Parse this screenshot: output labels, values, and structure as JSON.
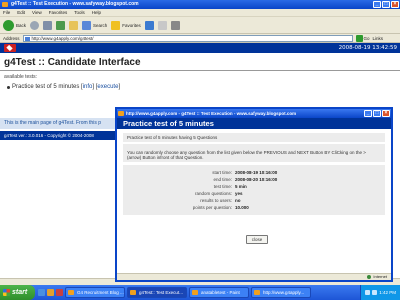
{
  "browser": {
    "title": "g4Test :: Test Execution - www.safyway.blogspot.com",
    "menu": [
      "File",
      "Edit",
      "View",
      "Favorites",
      "Tools",
      "Help"
    ],
    "back_label": "Back",
    "search_label": "Search",
    "favorites_label": "Favorites",
    "address_label": "Address",
    "url": "http://www.g4apply.com/g4test/",
    "go_label": "Go",
    "links_label": "Links"
  },
  "page": {
    "datetime": "2008-08-19 13:42:59",
    "title": "g4Test :: Candidate Interface",
    "available_label": "available tests:",
    "test_name": "Practice test of 5 minutes",
    "info_link": "info",
    "execute_link": "execute",
    "info_text": "This is the main page of g4Test. From this p",
    "footer_text": "g4Test ver.: 3.0.016 - Copyright © 2004-2008"
  },
  "popup": {
    "window_title": "http://www.g4apply.com - g4Test :: Test Execution - www.safyway.blogspot.com",
    "header": "Practice test of 5 minutes",
    "description": "Practice test of 5 minutes having 5 Questions",
    "instructions": "You can randomly choose any question from the list given below the PREVIOUS and NEXT Button BY CliCking on the > (arrow) Button infront of that Question.",
    "details": [
      {
        "label": "start time:",
        "value": "2008-08-19 10:16:00"
      },
      {
        "label": "end time:",
        "value": "2008-08-20 10:16:00"
      },
      {
        "label": "test time:",
        "value": "5 min"
      },
      {
        "label": "random questions:",
        "value": "yes"
      },
      {
        "label": "results to users:",
        "value": "no"
      },
      {
        "label": "points per question:",
        "value": "10.000"
      }
    ],
    "close_label": "close",
    "status_zone": "Internet"
  },
  "taskbar": {
    "start_label": "start",
    "tasks": [
      {
        "label": "G4 Recruitment Blog ...",
        "active": false
      },
      {
        "label": "g4Test:: Test Execut...",
        "active": true
      },
      {
        "label": "anatabletest - Paint",
        "active": false
      },
      {
        "label": "http://www.g4apply...",
        "active": false
      }
    ],
    "clock": "1:42 PM"
  }
}
